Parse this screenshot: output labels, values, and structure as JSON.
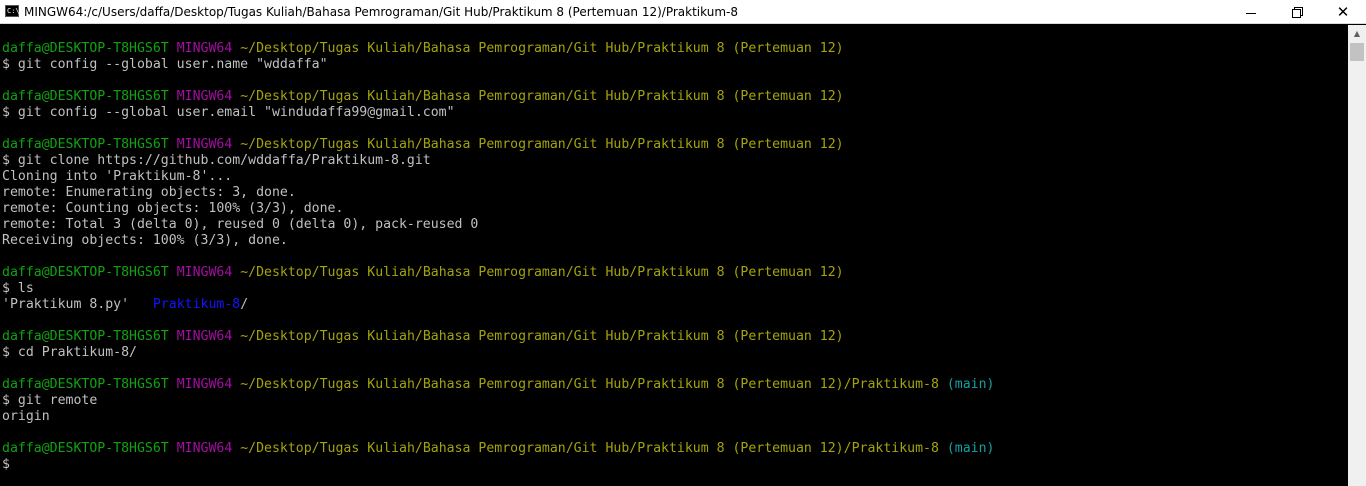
{
  "window": {
    "title": "MINGW64:/c/Users/daffa/Desktop/Tugas Kuliah/Bahasa Pemrograman/Git Hub/Praktikum 8 (Pertemuan 12)/Praktikum-8",
    "icon_label": "C:\\",
    "minimize_label": "minimize",
    "maximize_label": "restore",
    "close_label": "✕"
  },
  "colors": {
    "user": "#11a311",
    "host": "#a20fa2",
    "path": "#a3a30d",
    "branch": "#12a0a0",
    "directory": "#1414ff",
    "text": "#c0c0c0",
    "background": "#000000"
  },
  "prompt": {
    "user": "daffa@DESKTOP-T8HGS6T",
    "host": "MINGW64",
    "path_base": "~/Desktop/Tugas Kuliah/Bahasa Pemrograman/Git Hub/Praktikum 8 (Pertemuan 12)",
    "path_repo": "~/Desktop/Tugas Kuliah/Bahasa Pemrograman/Git Hub/Praktikum 8 (Pertemuan 12)/Praktikum-8",
    "branch": "(main)",
    "symbol": "$"
  },
  "terminal": {
    "cmd1": "$ git config --global user.name \"wddaffa\"",
    "cmd2": "$ git config --global user.email \"windudaffa99@gmail.com\"",
    "cmd3": "$ git clone https://github.com/wddaffa/Praktikum-8.git",
    "clone_output": [
      "Cloning into 'Praktikum-8'...",
      "remote: Enumerating objects: 3, done.",
      "remote: Counting objects: 100% (3/3), done.",
      "remote: Total 3 (delta 0), reused 0 (delta 0), pack-reused 0",
      "Receiving objects: 100% (3/3), done."
    ],
    "cmd4": "$ ls",
    "ls_file": "'Praktikum 8.py'",
    "ls_dir": "Praktikum-8",
    "ls_dir_suffix": "/",
    "cmd5": "$ cd Praktikum-8/",
    "cmd6": "$ git remote",
    "remote_output": "origin",
    "final_prompt": "$"
  }
}
